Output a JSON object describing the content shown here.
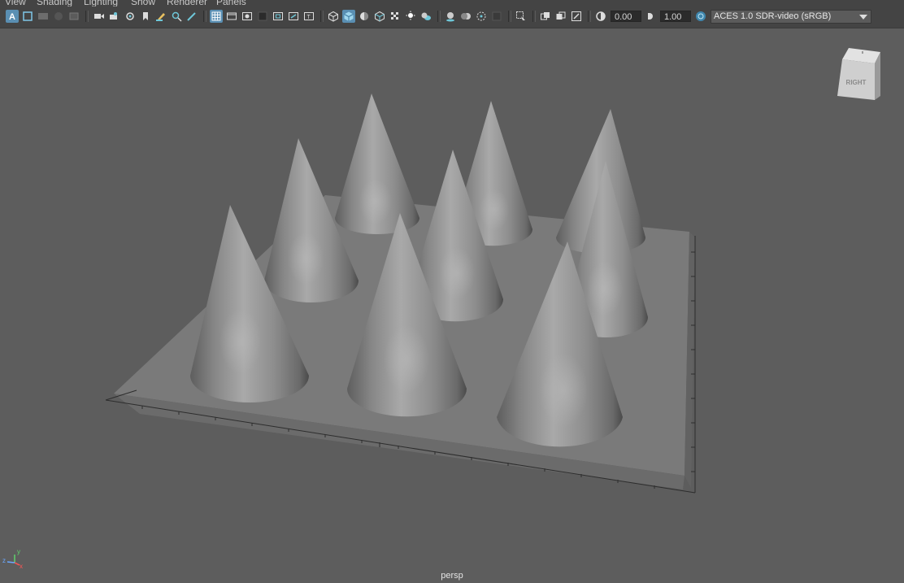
{
  "menu": {
    "items": [
      "View",
      "Shading",
      "Lighting",
      "Show",
      "Renderer",
      "Panels"
    ]
  },
  "toolbar": {
    "exposure_value": "0.00",
    "gamma_value": "1.00",
    "color_space": "ACES 1.0 SDR-video (sRGB)",
    "icons": [
      "select-camera-icon",
      "camera-attributes-icon",
      "bookmarks-icon",
      "image-plane-icon",
      "grid-icon",
      "film-gate-icon",
      "resolution-gate-icon",
      "gate-mask-icon",
      "wireframe-icon",
      "smooth-shade-icon",
      "textured-icon",
      "lighting-icon",
      "shadows-icon",
      "isolate-select-icon",
      "xray-icon",
      "color-management-icon"
    ],
    "accent_color": "#5a8fb3"
  },
  "viewport": {
    "camera_name": "persp",
    "view_cube_label": "RIGHT",
    "axis_labels": {
      "x": "x",
      "y": "y",
      "z": "z"
    },
    "background_color": "#5d5d5d"
  }
}
